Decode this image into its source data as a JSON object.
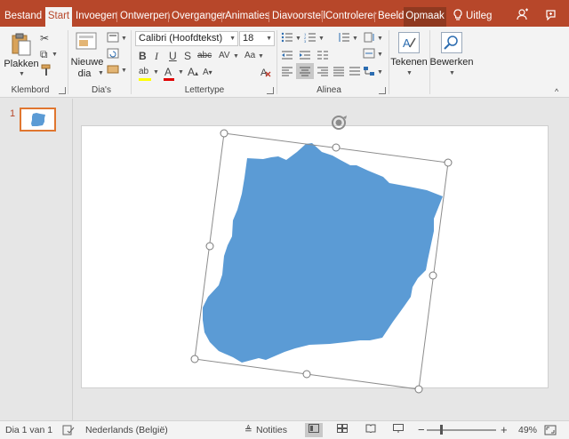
{
  "tabs": [
    {
      "id": "bestand",
      "label": "Bestand"
    },
    {
      "id": "start",
      "label": "Start"
    },
    {
      "id": "invoegen",
      "label": "Invoegen"
    },
    {
      "id": "ontwerpen",
      "label": "Ontwerpen"
    },
    {
      "id": "overganger",
      "label": "Overganger"
    },
    {
      "id": "animaties",
      "label": "Animaties"
    },
    {
      "id": "diavoorstell",
      "label": "Diavoorstell"
    },
    {
      "id": "controlerer",
      "label": "Controlerer"
    },
    {
      "id": "beeld",
      "label": "Beeld"
    },
    {
      "id": "opmaak",
      "label": "Opmaak"
    }
  ],
  "tell_me": "Uitleg",
  "ribbon": {
    "klembord": {
      "label": "Klembord",
      "paste": "Plakken"
    },
    "dias": {
      "label": "Dia's",
      "new_slide_1": "Nieuwe",
      "new_slide_2": "dia"
    },
    "lettertype": {
      "label": "Lettertype",
      "font_name": "Calibri (Hoofdtekst)",
      "font_size": "18"
    },
    "alinea": {
      "label": "Alinea"
    },
    "tekenen": {
      "label": "Tekenen"
    },
    "bewerken": {
      "label": "Bewerken"
    }
  },
  "thumbnail": {
    "number": "1"
  },
  "status": {
    "slide_counter": "Dia 1 van 1",
    "language": "Nederlands (België)",
    "notes": "Notities",
    "zoom": "49%"
  },
  "colors": {
    "accent": "#b7472a",
    "shape_fill": "#5b9bd5",
    "thumb_border": "#e0762f"
  }
}
